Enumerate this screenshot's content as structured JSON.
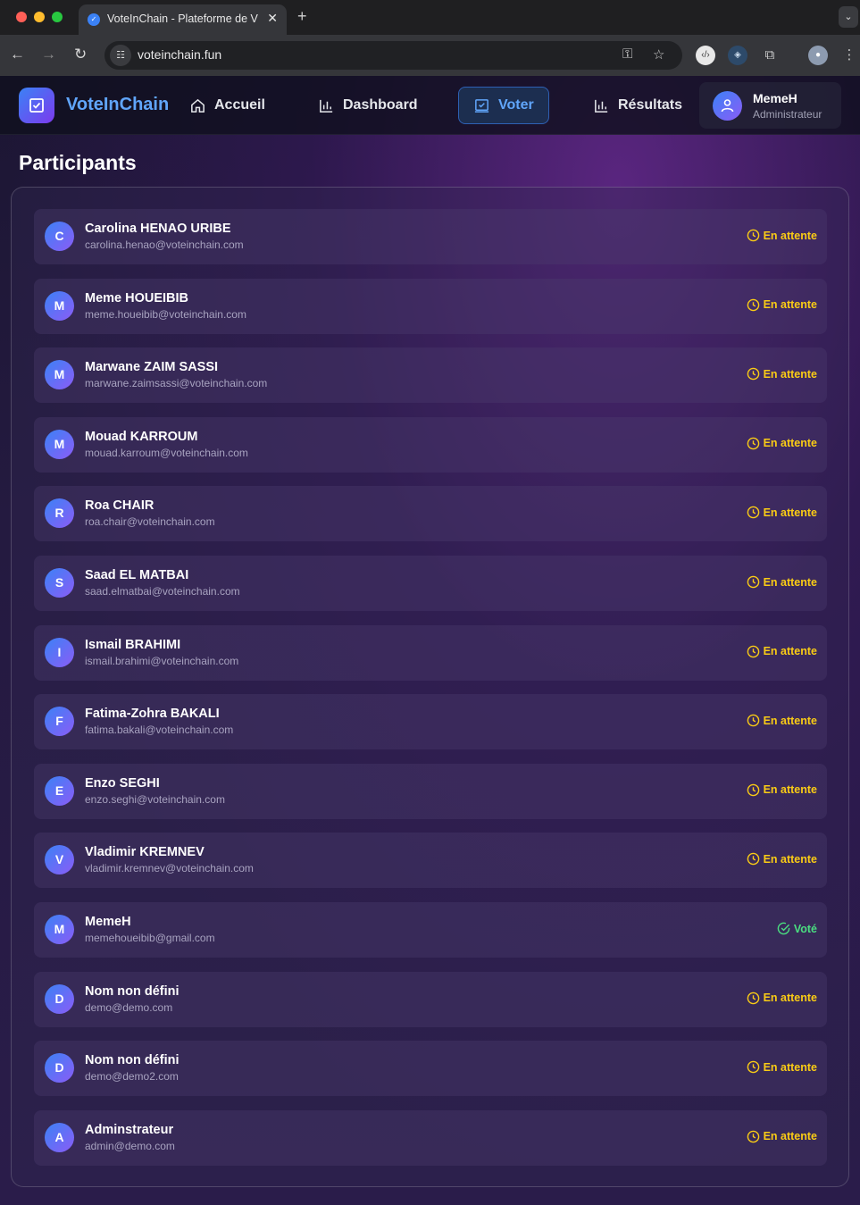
{
  "browser": {
    "tab_title": "VoteInChain - Plateforme de V",
    "url": "voteinchain.fun"
  },
  "header": {
    "brand": "VoteInChain",
    "nav": [
      {
        "label": "Accueil",
        "icon": "home-icon"
      },
      {
        "label": "Dashboard",
        "icon": "bar-chart-icon"
      },
      {
        "label": "Voter",
        "icon": "vote-box-icon",
        "active": true
      },
      {
        "label": "Résultats",
        "icon": "bar-chart-icon"
      }
    ],
    "user": {
      "name": "MemeH",
      "role": "Administrateur"
    }
  },
  "page": {
    "title": "Participants"
  },
  "participants": [
    {
      "initial": "C",
      "name": "Carolina HENAO URIBE",
      "email": "carolina.henao@voteinchain.com",
      "status": "En attente",
      "voted": false
    },
    {
      "initial": "M",
      "name": "Meme HOUEIBIB",
      "email": "meme.houeibib@voteinchain.com",
      "status": "En attente",
      "voted": false
    },
    {
      "initial": "M",
      "name": "Marwane ZAIM SASSI",
      "email": "marwane.zaimsassi@voteinchain.com",
      "status": "En attente",
      "voted": false
    },
    {
      "initial": "M",
      "name": "Mouad KARROUM",
      "email": "mouad.karroum@voteinchain.com",
      "status": "En attente",
      "voted": false
    },
    {
      "initial": "R",
      "name": "Roa CHAIR",
      "email": "roa.chair@voteinchain.com",
      "status": "En attente",
      "voted": false
    },
    {
      "initial": "S",
      "name": "Saad EL MATBAI",
      "email": "saad.elmatbai@voteinchain.com",
      "status": "En attente",
      "voted": false
    },
    {
      "initial": "I",
      "name": "Ismail BRAHIMI",
      "email": "ismail.brahimi@voteinchain.com",
      "status": "En attente",
      "voted": false
    },
    {
      "initial": "F",
      "name": "Fatima-Zohra BAKALI",
      "email": "fatima.bakali@voteinchain.com",
      "status": "En attente",
      "voted": false
    },
    {
      "initial": "E",
      "name": "Enzo SEGHI",
      "email": "enzo.seghi@voteinchain.com",
      "status": "En attente",
      "voted": false
    },
    {
      "initial": "V",
      "name": "Vladimir KREMNEV",
      "email": "vladimir.kremnev@voteinchain.com",
      "status": "En attente",
      "voted": false
    },
    {
      "initial": "M",
      "name": "MemeH",
      "email": "memehoueibib@gmail.com",
      "status": "Voté",
      "voted": true
    },
    {
      "initial": "D",
      "name": "Nom non défini",
      "email": "demo@demo.com",
      "status": "En attente",
      "voted": false
    },
    {
      "initial": "D",
      "name": "Nom non défini",
      "email": "demo@demo2.com",
      "status": "En attente",
      "voted": false
    },
    {
      "initial": "A",
      "name": "Adminstrateur",
      "email": "admin@demo.com",
      "status": "En attente",
      "voted": false
    }
  ],
  "colors": {
    "brand": "#60a5fa",
    "pending": "#facc15",
    "voted": "#4ade80"
  }
}
